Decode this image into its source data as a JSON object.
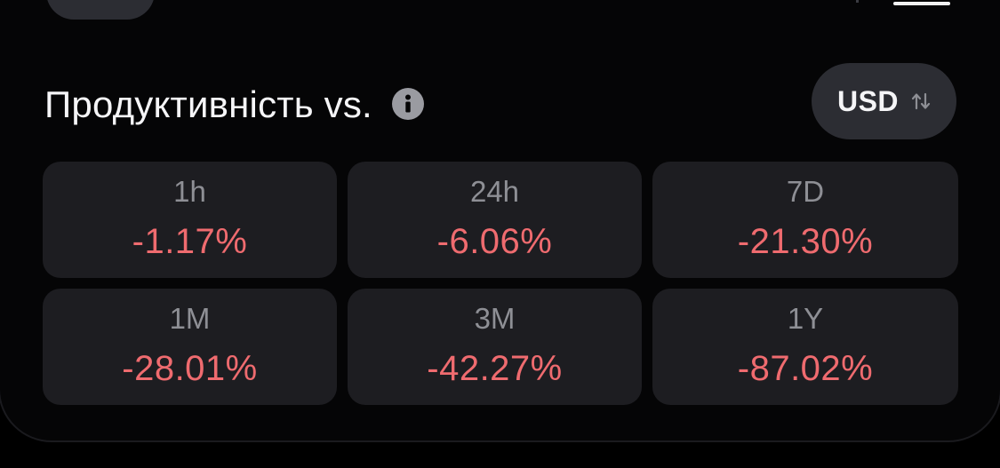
{
  "header": {
    "title": "Продуктивність vs.",
    "info_icon": "info-icon"
  },
  "currency": {
    "label": "USD",
    "icon": "swap-arrows-icon"
  },
  "performance": [
    {
      "period": "1h",
      "change": "-1.17%"
    },
    {
      "period": "24h",
      "change": "-6.06%"
    },
    {
      "period": "7D",
      "change": "-21.30%"
    },
    {
      "period": "1M",
      "change": "-28.01%"
    },
    {
      "period": "3M",
      "change": "-42.27%"
    },
    {
      "period": "1Y",
      "change": "-87.02%"
    }
  ],
  "colors": {
    "background": "#000000",
    "cell_background": "#1d1d21",
    "negative": "#ef6b6f",
    "label": "#8e8f95",
    "button": "#2c2d33"
  }
}
